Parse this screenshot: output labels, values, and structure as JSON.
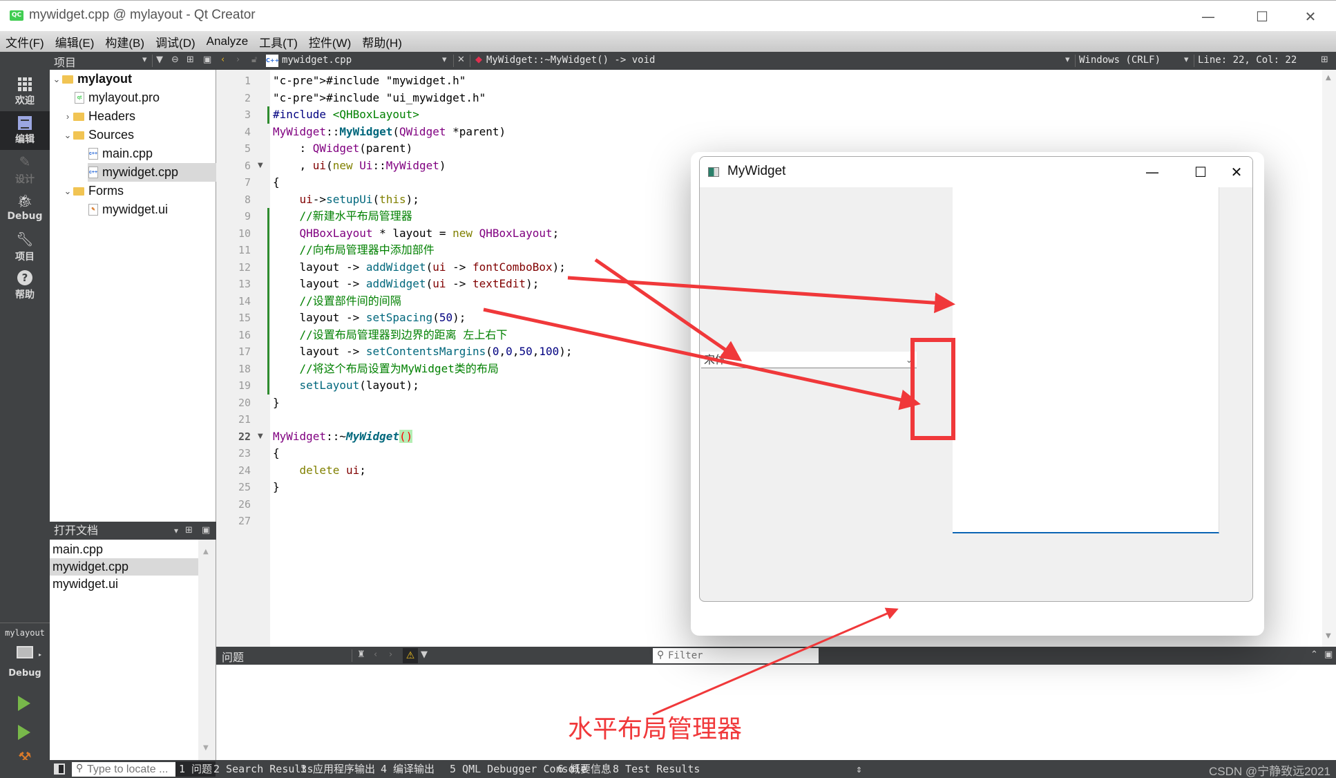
{
  "window": {
    "logo": "QC",
    "title": "mywidget.cpp @ mylayout - Qt Creator",
    "controls": {
      "minimize": "—",
      "maximize": "☐",
      "close": "✕"
    }
  },
  "menu": [
    "文件(F)",
    "编辑(E)",
    "构建(B)",
    "调试(D)",
    "Analyze",
    "工具(T)",
    "控件(W)",
    "帮助(H)"
  ],
  "toolbar": {
    "project_pane_title": "项目",
    "file_tab": "mywidget.cpp",
    "symbol": "MyWidget::~MyWidget() -> void",
    "line_ending": "Windows (CRLF)",
    "cursor_pos": "Line: 22, Col: 22"
  },
  "modes": [
    {
      "label": "欢迎",
      "icon": "grid-icon"
    },
    {
      "label": "编辑",
      "icon": "edit-icon",
      "active": true
    },
    {
      "label": "设计",
      "icon": "pencil-icon",
      "disabled": true
    },
    {
      "label": "Debug",
      "icon": "bug-icon"
    },
    {
      "label": "项目",
      "icon": "wrench-icon"
    },
    {
      "label": "帮助",
      "icon": "help-icon"
    }
  ],
  "kit": {
    "project": "mylayout",
    "build": "Debug"
  },
  "project_tree": [
    {
      "label": "mylayout",
      "level": 0,
      "kind": "project",
      "expanded": true,
      "bold": true
    },
    {
      "label": "mylayout.pro",
      "level": 1,
      "kind": "pro"
    },
    {
      "label": "Headers",
      "level": 1,
      "kind": "folder",
      "expanded": false
    },
    {
      "label": "Sources",
      "level": 1,
      "kind": "folder",
      "expanded": true
    },
    {
      "label": "main.cpp",
      "level": 2,
      "kind": "cpp"
    },
    {
      "label": "mywidget.cpp",
      "level": 2,
      "kind": "cpp",
      "selected": true
    },
    {
      "label": "Forms",
      "level": 1,
      "kind": "folder",
      "expanded": true
    },
    {
      "label": "mywidget.ui",
      "level": 2,
      "kind": "ui"
    }
  ],
  "open_documents": {
    "title": "打开文档",
    "items": [
      "main.cpp",
      "mywidget.cpp",
      "mywidget.ui"
    ],
    "selected": 1
  },
  "editor": {
    "current_line": 22,
    "lines": [
      "#include \"mywidget.h\"",
      "#include \"ui_mywidget.h\"",
      "#include <QHBoxLayout>",
      "MyWidget::MyWidget(QWidget *parent)",
      "    : QWidget(parent)",
      "    , ui(new Ui::MyWidget)",
      "{",
      "    ui->setupUi(this);",
      "    //新建水平布局管理器",
      "    QHBoxLayout * layout = new QHBoxLayout;",
      "    //向布局管理器中添加部件",
      "    layout -> addWidget(ui -> fontComboBox);",
      "    layout -> addWidget(ui -> textEdit);",
      "    //设置部件间的间隔",
      "    layout -> setSpacing(50);",
      "    //设置布局管理器到边界的距离 左上右下",
      "    layout -> setContentsMargins(0,0,50,100);",
      "    //将这个布局设置为MyWidget类的布局",
      "    setLayout(layout);",
      "}",
      "",
      "MyWidget::~MyWidget()",
      "{",
      "    delete ui;",
      "}",
      "",
      ""
    ]
  },
  "issues": {
    "title": "问题",
    "filter_placeholder": "Filter"
  },
  "statusbar": {
    "locator_placeholder": "Type to locate ...",
    "tabs": [
      "1 问题",
      "2 Search Results",
      "3 应用程序输出",
      "4 编译输出",
      "5 QML Debugger Console",
      "6 概要信息",
      "8 Test Results"
    ],
    "watermark": "CSDN @宁静致远2021"
  },
  "mywidget": {
    "title": "MyWidget",
    "font_combo_value": "宋体"
  },
  "annotation": {
    "label": "水平布局管理器",
    "color": "#f0383a"
  }
}
